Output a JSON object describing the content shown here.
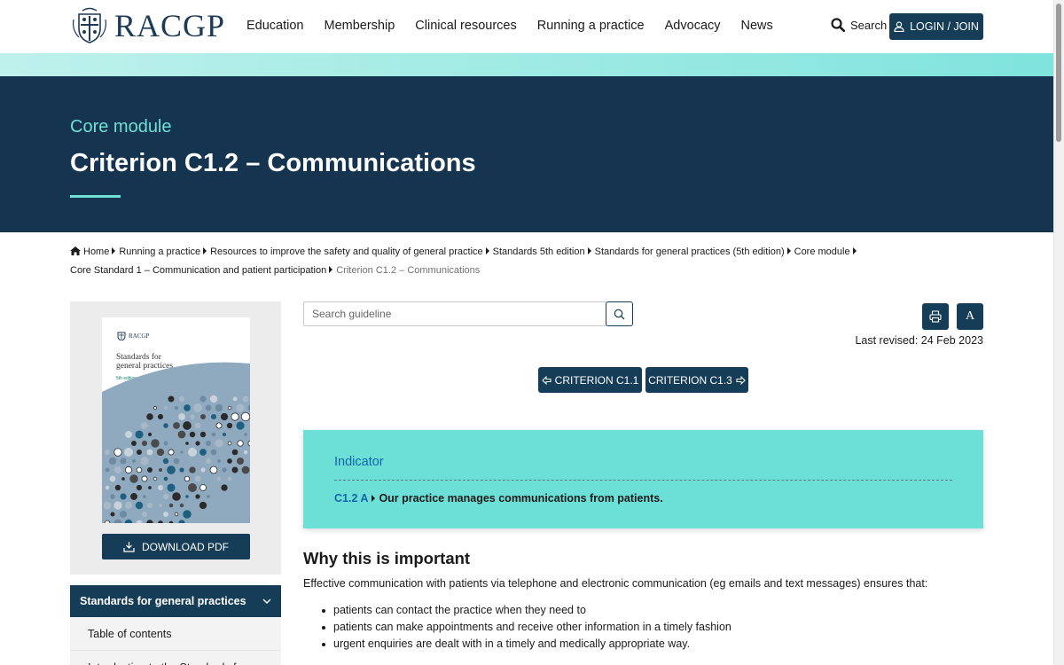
{
  "brand": {
    "name": "RACGP"
  },
  "nav": {
    "items": [
      "Education",
      "Membership",
      "Clinical resources",
      "Running a practice",
      "Advocacy",
      "News"
    ],
    "search_label": "Search",
    "login_label": "LOGIN / JOIN"
  },
  "hero": {
    "kicker": "Core module",
    "title": "Criterion C1.2 – Communications"
  },
  "breadcrumb": {
    "items": [
      "Home",
      "Running a practice",
      "Resources to improve the safety and quality of general practice",
      "Standards 5th edition",
      "Standards for general practices (5th edition)",
      "Core module",
      "Core Standard 1 – Communication and patient participation"
    ],
    "current": "Criterion C1.2 – Communications"
  },
  "sidebar": {
    "book": {
      "logo_text": "RACGP",
      "title_line1": "Standards for",
      "title_line2": "general practices",
      "edition": "5th edition"
    },
    "download_label": "DOWNLOAD PDF",
    "nav_heading": "Standards for general practices",
    "nav_items": [
      "Table of contents",
      "Introduction to the Standards for general practices"
    ]
  },
  "search": {
    "placeholder": "Search guideline"
  },
  "tools": {
    "font_size_label": "A",
    "last_revised": "Last revised: 24 Feb 2023"
  },
  "criteria_nav": {
    "prev_label": "CRITERION C1.1",
    "next_label": "CRITERION C1.3"
  },
  "indicator": {
    "label": "Indicator",
    "code": "C1.2 A",
    "statement": "Our practice manages communications from patients."
  },
  "content": {
    "heading": "Why this is important",
    "intro": "Effective communication with patients via telephone and electronic communication (eg emails and text messages) ensures that:",
    "bullets": [
      "patients can contact the practice when they need to",
      "patients can make appointments and receive other information in a timely fashion",
      "urgent enquiries are dealt with in a timely and medically appropriate way."
    ]
  },
  "colors": {
    "navy": "#163d58",
    "hero_bg": "#143450",
    "teal": "#6ce0d7",
    "link_blue": "#1365a8"
  }
}
